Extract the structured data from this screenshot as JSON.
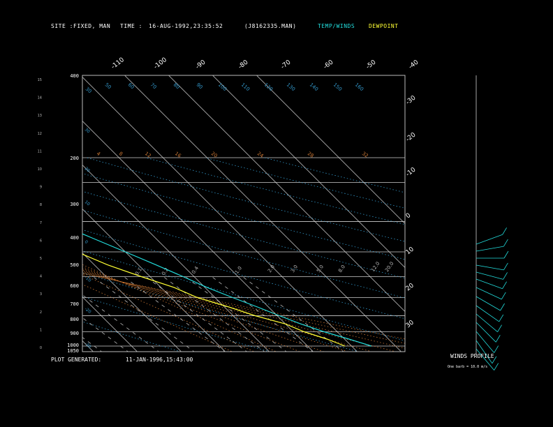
{
  "header": {
    "site_label": "SITE :",
    "site_value": "FIXED, MAN",
    "time_label": "TIME :",
    "time_value": "16-AUG-1992,23:35:52",
    "file": "(J8162335.MAN)",
    "temp_winds_label": "TEMP/WINDS",
    "dewpoint_label": "DEWPOINT",
    "temp_color": "#22dddd",
    "dewpoint_color": "#ffff33"
  },
  "footer": {
    "plot_generated_label": "PLOT GENERATED:",
    "plot_generated_value": "11-JAN-1996,15:43:00"
  },
  "winds_profile": {
    "title": "WINDS PROFILE",
    "note": "One barb = 10.0 m/s"
  },
  "chart_data": {
    "type": "line",
    "title": "",
    "xlabel": "",
    "ylabel": "",
    "pressure_ticks": [
      "400",
      "200",
      "300",
      "400",
      "500",
      "600",
      "700",
      "800",
      "900",
      "1000",
      "1050"
    ],
    "height_ticks": [
      "15",
      "14",
      "13",
      "12",
      "11",
      "10",
      "9",
      "8",
      "7",
      "6",
      "5",
      "4",
      "3",
      "2",
      "1",
      "0"
    ],
    "isotherm_top_labels": [
      "-110",
      "-100",
      "-90",
      "-80",
      "-70",
      "-60",
      "-50",
      "-40"
    ],
    "isotherm_right_labels": [
      "-30",
      "-20",
      "-10",
      "0",
      "10",
      "20",
      "30"
    ],
    "dry_adiabat_labels": [
      "30",
      "50",
      "60",
      "70",
      "80",
      "90",
      "100",
      "110",
      "120",
      "130",
      "140",
      "150",
      "160"
    ],
    "mixing_ratio_labels": [
      "0.1",
      "0.2",
      "0.4",
      "1.0",
      "2.0",
      "3.0",
      "5.0",
      "8.0",
      "12.0",
      "20.0"
    ],
    "orange_labels": [
      "4",
      "8",
      "12",
      "16",
      "20",
      "24",
      "28",
      "32"
    ],
    "series": [
      {
        "name": "TEMP/WINDS",
        "color": "#22dddd",
        "pressure": [
          1000,
          950,
          900,
          850,
          800,
          750,
          700,
          650,
          600,
          550,
          500,
          450,
          400
        ],
        "temperature": [
          24.5,
          21,
          17,
          13.5,
          10.5,
          7.5,
          4,
          0.5,
          -2.5,
          -6,
          -10,
          -14.5,
          -19.5
        ]
      },
      {
        "name": "DEWPOINT",
        "color": "#ffff33",
        "pressure": [
          1000,
          950,
          900,
          850,
          800,
          750,
          700,
          650,
          600,
          550,
          500,
          450,
          400
        ],
        "temperature": [
          18.5,
          16,
          12.5,
          10,
          5,
          1,
          -4,
          -7,
          -12,
          -17,
          -21,
          -27,
          -33
        ]
      }
    ]
  }
}
